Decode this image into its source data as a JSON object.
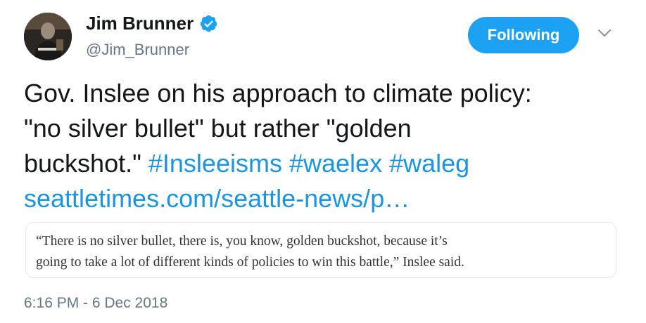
{
  "user": {
    "name": "Jim Brunner",
    "handle": "@Jim_Brunner",
    "verified_icon": "verified-badge-icon",
    "verified_color": "#1da1f2"
  },
  "follow_button": {
    "label": "Following",
    "color": "#1da1f2"
  },
  "menu_icon": "chevron-down-icon",
  "tweet": {
    "text_line1": "Gov. Inslee on his approach to climate policy:",
    "text_line2": "\"no silver bullet\" but rather \"golden",
    "text_line3": "buckshot.\"",
    "hashtags": [
      "#Insleeisms",
      "#waelex",
      "#waleg"
    ],
    "link": "seattletimes.com/seattle-news/p…",
    "link_color": "#1b95e0"
  },
  "quote_card": {
    "line1": "“There is no silver bullet, there is, you know, golden buckshot, because it’s",
    "line2": "going to take a lot of different kinds of policies to win this battle,” Inslee said."
  },
  "timestamp": "6:16 PM - 6 Dec 2018"
}
